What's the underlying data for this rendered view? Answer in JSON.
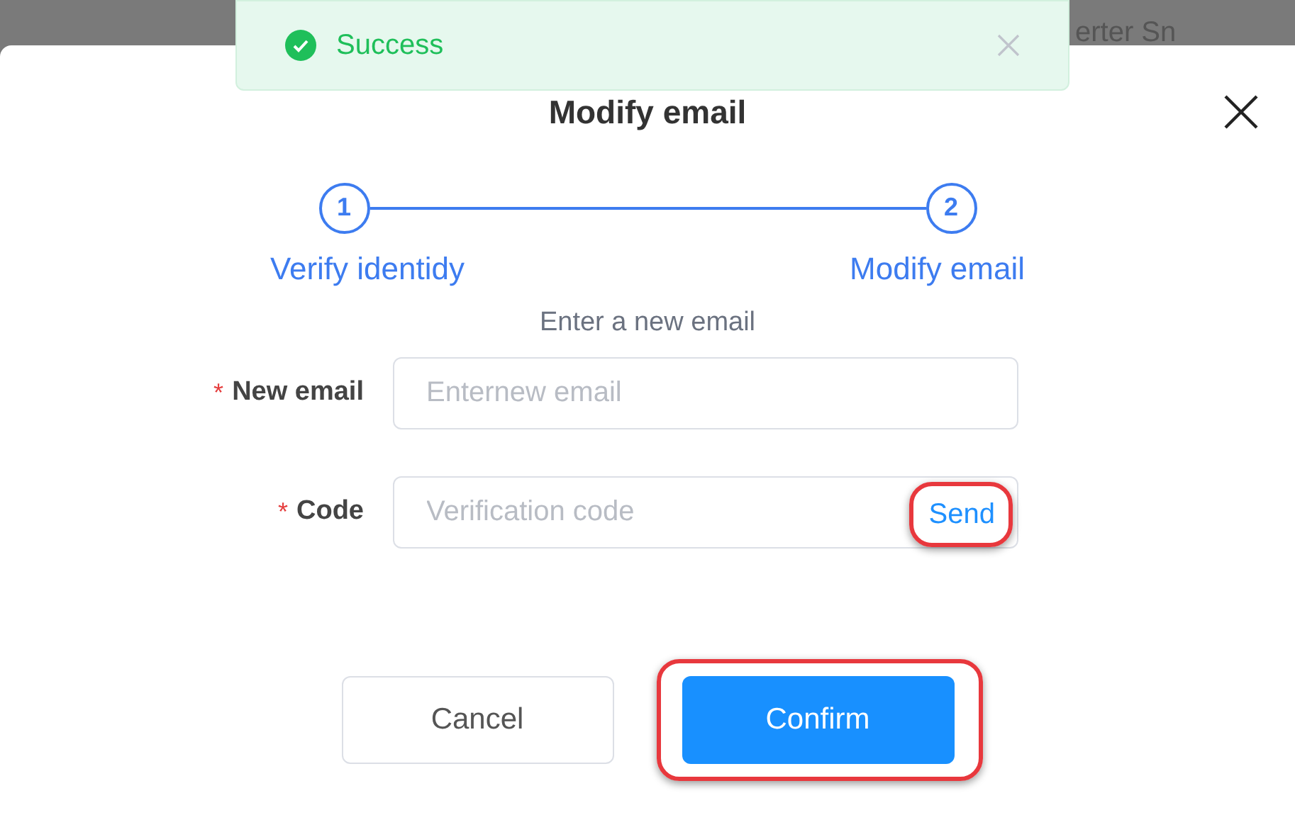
{
  "background": {
    "field_text": "erter Sn"
  },
  "toast": {
    "kind": "success",
    "message": "Success"
  },
  "dialog": {
    "title": "Modify email",
    "steps": [
      {
        "number": "1",
        "label": "Verify identidy",
        "done": true
      },
      {
        "number": "2",
        "label": "Modify email",
        "done": true
      }
    ],
    "instruction": "Enter a new email",
    "fields": [
      {
        "label": "New email",
        "required_mark": "*",
        "placeholder": "Enternew email"
      },
      {
        "label": "Code",
        "required_mark": "*",
        "placeholder": "Verification code",
        "action": {
          "label": "Send",
          "highlighted": true
        }
      }
    ],
    "buttons": [
      {
        "label": "Cancel",
        "kind": "secondary",
        "highlighted": false
      },
      {
        "label": "Confirm",
        "kind": "primary",
        "highlighted": true
      }
    ]
  }
}
